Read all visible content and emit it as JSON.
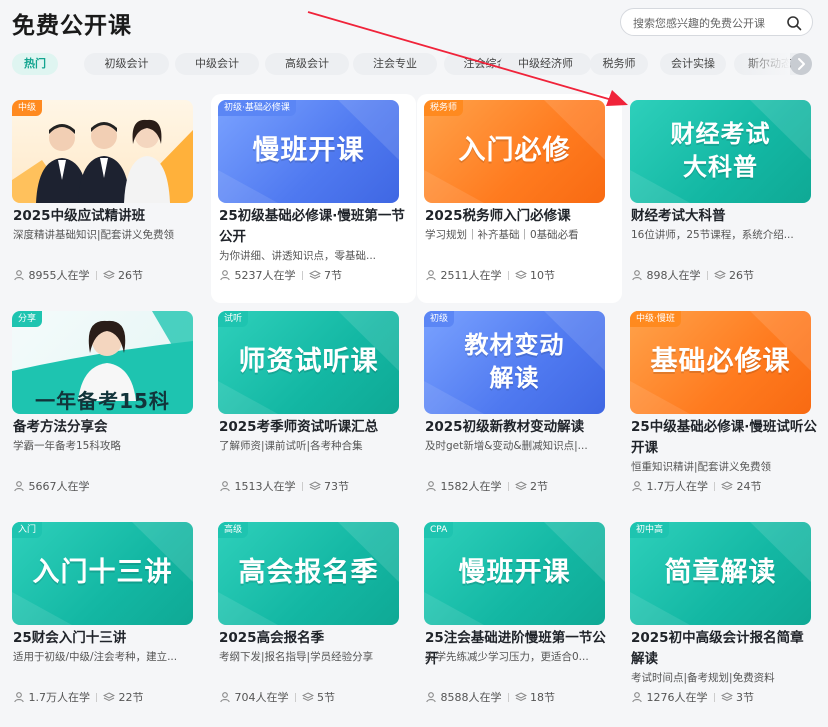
{
  "page": {
    "title": "免费公开课"
  },
  "search": {
    "placeholder": "搜索您感兴趣的免费公开课"
  },
  "categories": [
    "热门",
    "初级会计",
    "中级会计",
    "高级会计",
    "注会专业",
    "注会综合",
    "中级经济师",
    "税务师",
    "会计实操",
    "斯尔动态"
  ],
  "colors": {
    "accent": "#12a48f",
    "tag_orange": "#ff8a1f",
    "tag_teal": "#1ec4b0",
    "tag_blue": "#5b86f5",
    "arrow": "#f0233a"
  },
  "stats_labels": {
    "learners_suffix": "人在学",
    "lessons_suffix": "节"
  },
  "courses": [
    {
      "tag": "中级",
      "tag_color": "#ff8a1f",
      "thumb_text": "",
      "thumb_style": "people",
      "title": "2025中级应试精讲班",
      "desc": "深度精讲基础知识|配套讲义免费领",
      "learners": "8955",
      "lessons": "26"
    },
    {
      "tag": "初级·基础必修课",
      "tag_color": "#5b86f5",
      "thumb_text": "慢班开课",
      "thumb_style": "blue",
      "title": "25初级基础必修课·慢班第一节公开",
      "desc": "为你讲细、讲透知识点，零基础...",
      "learners": "5237",
      "lessons": "7"
    },
    {
      "tag": "税务师",
      "tag_color": "#ff8a1f",
      "thumb_text": "入门必修",
      "thumb_style": "orange",
      "title": "2025税务师入门必修课",
      "desc": "学习规划｜补齐基础｜0基础必看",
      "learners": "2511",
      "lessons": "10"
    },
    {
      "tag": "",
      "tag_color": "",
      "thumb_text": "财经考试\n大科普",
      "thumb_style": "teal",
      "title": "财经考试大科普",
      "desc": "16位讲师，25节课程，系统介绍...",
      "learners": "898",
      "lessons": "26"
    },
    {
      "tag": "分享",
      "tag_color": "#1ec4b0",
      "thumb_text": "一年备考15科",
      "thumb_style": "lady",
      "title": "备考方法分享会",
      "desc": "学霸一年备考15科攻略",
      "learners": "5667",
      "lessons": ""
    },
    {
      "tag": "试听",
      "tag_color": "#1ec4b0",
      "thumb_text": "师资试听课",
      "thumb_style": "teal",
      "title": "2025考季师资试听课汇总",
      "desc": "了解师资|课前试听|各考种合集",
      "learners": "1513",
      "lessons": "73"
    },
    {
      "tag": "初级",
      "tag_color": "#5b86f5",
      "thumb_text": "教材变动\n解读",
      "thumb_style": "blue",
      "title": "2025初级新教材变动解读",
      "desc": "及时get新增&变动&删减知识点|...",
      "learners": "1582",
      "lessons": "2"
    },
    {
      "tag": "中级·慢班",
      "tag_color": "#ff8a1f",
      "thumb_text": "基础必修课",
      "thumb_style": "orange",
      "title": "25中级基础必修课·慢班试听公开课",
      "desc": "恒重知识精讲|配套讲义免费领",
      "learners": "1.7万",
      "lessons": "24"
    },
    {
      "tag": "入门",
      "tag_color": "#1ec4b0",
      "thumb_text": "入门十三讲",
      "thumb_style": "teal",
      "title": "25财会入门十三讲",
      "desc": "适用于初级/中级/注会考种，建立...",
      "learners": "1.7万",
      "lessons": "22"
    },
    {
      "tag": "高级",
      "tag_color": "#1ec4b0",
      "thumb_text": "高会报名季",
      "thumb_style": "teal",
      "title": "2025高会报名季",
      "desc": "考纲下发|报名指导|学员经验分享",
      "learners": "704",
      "lessons": "5"
    },
    {
      "tag": "CPA",
      "tag_color": "#1ec4b0",
      "thumb_text": "慢班开课",
      "thumb_style": "teal",
      "title": "25注会基础进阶慢班第一节公开",
      "desc": "先学先练减少学习压力，更适合0...",
      "learners": "8588",
      "lessons": "18"
    },
    {
      "tag": "初中高",
      "tag_color": "#1ec4b0",
      "thumb_text": "简章解读",
      "thumb_style": "teal",
      "title": "2025初中高级会计报名简章解读",
      "desc": "考试时间点|备考规划|免费资料",
      "learners": "1276",
      "lessons": "3"
    }
  ]
}
